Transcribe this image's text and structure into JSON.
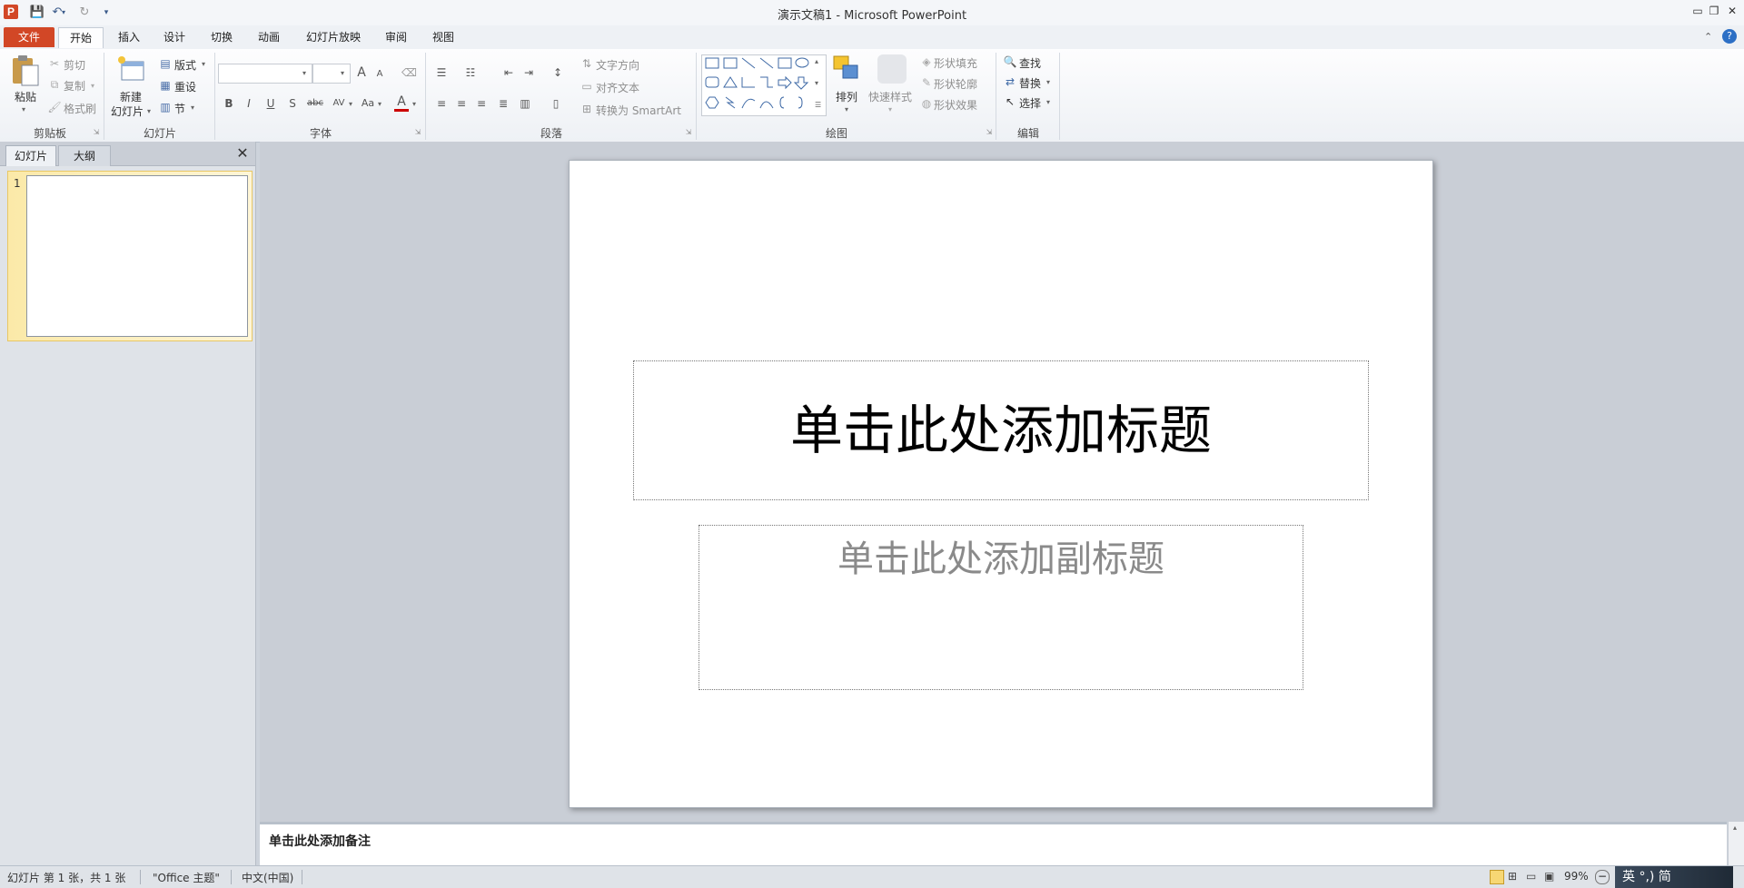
{
  "window": {
    "title": "演示文稿1  -  Microsoft PowerPoint",
    "app_icon_letter": "P"
  },
  "quick_access": {
    "save_icon": "save-icon",
    "undo_icon": "undo-icon",
    "redo_icon": "redo-icon",
    "customize_icon": "customize-icon"
  },
  "tabs": [
    {
      "label": "文件"
    },
    {
      "label": "开始"
    },
    {
      "label": "插入"
    },
    {
      "label": "设计"
    },
    {
      "label": "切换"
    },
    {
      "label": "动画"
    },
    {
      "label": "幻灯片放映"
    },
    {
      "label": "审阅"
    },
    {
      "label": "视图"
    }
  ],
  "ribbon": {
    "clipboard": {
      "label": "剪贴板",
      "paste": "粘贴",
      "cut": "剪切",
      "copy": "复制",
      "format_painter": "格式刷"
    },
    "slides": {
      "label": "幻灯片",
      "new_slide_line1": "新建",
      "new_slide_line2": "幻灯片",
      "layout": "版式",
      "reset": "重设",
      "section": "节"
    },
    "font": {
      "label": "字体",
      "bold": "B",
      "italic": "I",
      "underline": "U",
      "strike": "S",
      "strikethrough": "abc",
      "spacing": "AV",
      "case": "Aa",
      "color": "A",
      "grow": "A",
      "shrink": "A"
    },
    "paragraph": {
      "label": "段落",
      "text_direction": "文字方向",
      "align_text": "对齐文本",
      "convert_smartart": "转换为 SmartArt"
    },
    "drawing": {
      "label": "绘图",
      "arrange": "排列",
      "quick_styles": "快速样式",
      "shape_fill": "形状填充",
      "shape_outline": "形状轮廓",
      "shape_effects": "形状效果"
    },
    "editing": {
      "label": "编辑",
      "find": "查找",
      "replace": "替换",
      "select": "选择"
    }
  },
  "panel": {
    "tab_slides": "幻灯片",
    "tab_outline": "大纲",
    "slide_number": "1"
  },
  "slide": {
    "title_placeholder": "单击此处添加标题",
    "subtitle_placeholder": "单击此处添加副标题"
  },
  "notes": {
    "placeholder": "单击此处添加备注"
  },
  "status": {
    "slide_info": "幻灯片 第 1 张，共 1 张",
    "theme": "\"Office 主题\"",
    "language": "中文(中国)",
    "zoom": "99%",
    "ime_text": "英 °,) 简"
  }
}
